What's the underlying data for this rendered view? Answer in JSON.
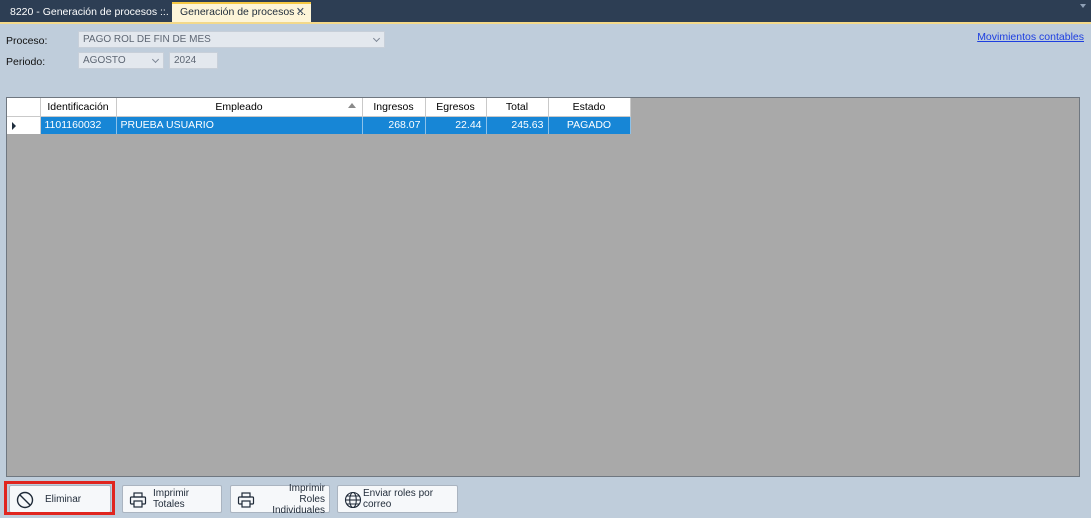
{
  "tabs": [
    {
      "label": "8220 - Generación de procesos ::."
    },
    {
      "label": "Generación de procesos ::."
    }
  ],
  "form": {
    "proceso_label": "Proceso:",
    "proceso_value": "PAGO ROL DE FIN DE MES",
    "periodo_label": "Periodo:",
    "periodo_month": "AGOSTO",
    "periodo_year": "2024"
  },
  "link_movimientos": "Movimientos contables",
  "table": {
    "headers": [
      "Identificación",
      "Empleado",
      "Ingresos",
      "Egresos",
      "Total",
      "Estado"
    ],
    "rows": [
      [
        "1101160032",
        "PRUEBA USUARIO",
        "268.07",
        "22.44",
        "245.63",
        "PAGADO"
      ]
    ]
  },
  "buttons": {
    "eliminar": "Eliminar",
    "imprimir_totales": "Imprimir Totales",
    "imprimir_roles_line1": "Imprimir Roles",
    "imprimir_roles_line2": "Individuales",
    "enviar_roles": "Enviar roles por correo"
  },
  "colors": {
    "tabbar": "#2d3e54",
    "background": "#bfcddb",
    "selection": "#1786d6",
    "highlight": "#e0251f"
  }
}
